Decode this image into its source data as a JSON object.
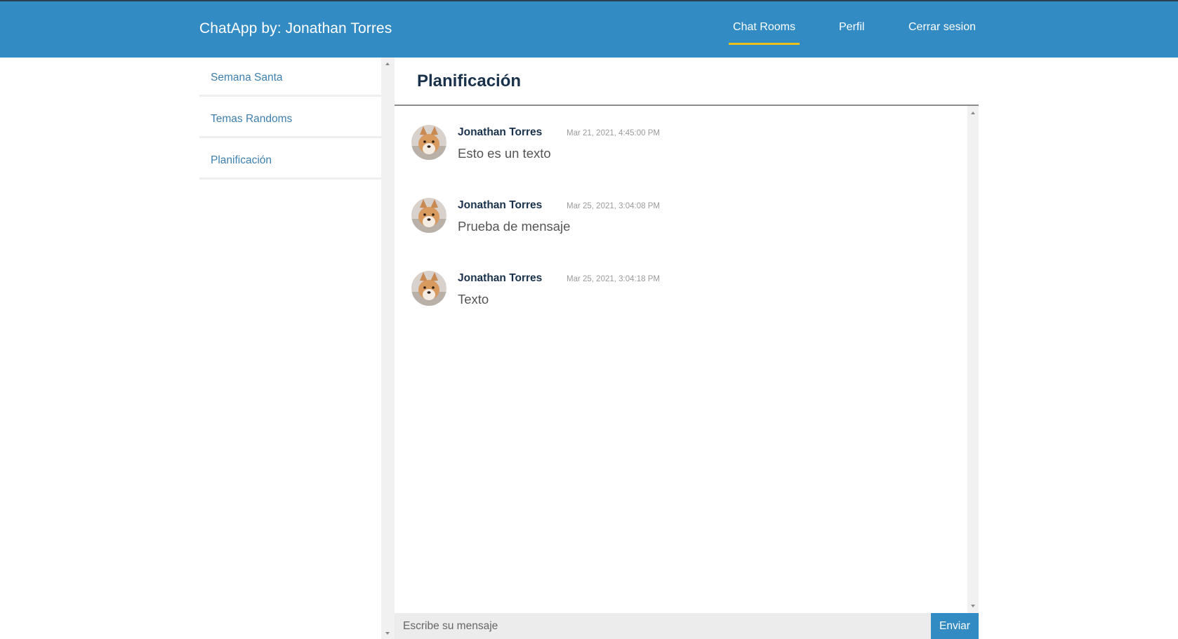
{
  "navbar": {
    "brand": "ChatApp by: Jonathan Torres",
    "items": [
      {
        "label": "Chat Rooms",
        "active": true
      },
      {
        "label": "Perfil"
      },
      {
        "label": "Cerrar sesion"
      }
    ],
    "active_underline_color": "#e8c21b",
    "background_color": "#338bc4"
  },
  "sidebar": {
    "rooms": [
      {
        "label": "Semana Santa"
      },
      {
        "label": "Temas Randoms"
      },
      {
        "label": "Planificación"
      }
    ]
  },
  "chat": {
    "title": "Planificación",
    "messages": [
      {
        "author": "Jonathan Torres",
        "time": "Mar 21, 2021, 4:45:00 PM",
        "text": "Esto es un texto",
        "avatar": "shiba-dog-avatar"
      },
      {
        "author": "Jonathan Torres",
        "time": "Mar 25, 2021, 3:04:08 PM",
        "text": "Prueba de mensaje",
        "avatar": "shiba-dog-avatar"
      },
      {
        "author": "Jonathan Torres",
        "time": "Mar 25, 2021, 3:04:18 PM",
        "text": "Texto",
        "avatar": "shiba-dog-avatar"
      }
    ],
    "composer": {
      "placeholder": "Escribe su mensaje",
      "value": "",
      "send_label": "Enviar"
    }
  }
}
